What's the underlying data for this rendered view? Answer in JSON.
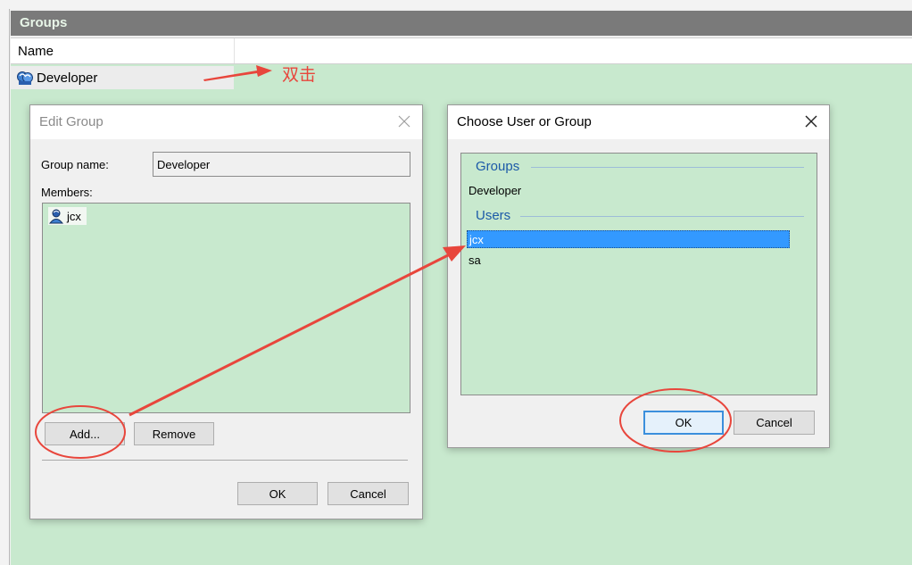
{
  "panel": {
    "header_title": "Groups",
    "column_name": "Name",
    "group_row_label": "Developer"
  },
  "annotation": {
    "double_click_text": "双击",
    "color": "#e8463c"
  },
  "edit_dialog": {
    "title": "Edit Group",
    "group_name_label": "Group name:",
    "group_name_value": "Developer",
    "members_label": "Members:",
    "members": [
      "jcx"
    ],
    "add_label": "Add...",
    "remove_label": "Remove",
    "ok_label": "OK",
    "cancel_label": "Cancel"
  },
  "choose_dialog": {
    "title": "Choose User or Group",
    "groups_heading": "Groups",
    "groups": [
      "Developer"
    ],
    "users_heading": "Users",
    "users": [
      "jcx",
      "sa"
    ],
    "selected_user": "jcx",
    "ok_label": "OK",
    "cancel_label": "Cancel"
  },
  "icons": {
    "group": "group-icon",
    "user": "user-icon",
    "close": "close-icon"
  },
  "colors": {
    "list_background": "#c8e9ce",
    "selection": "#3399ff",
    "header_bar": "#7a7a7a"
  }
}
